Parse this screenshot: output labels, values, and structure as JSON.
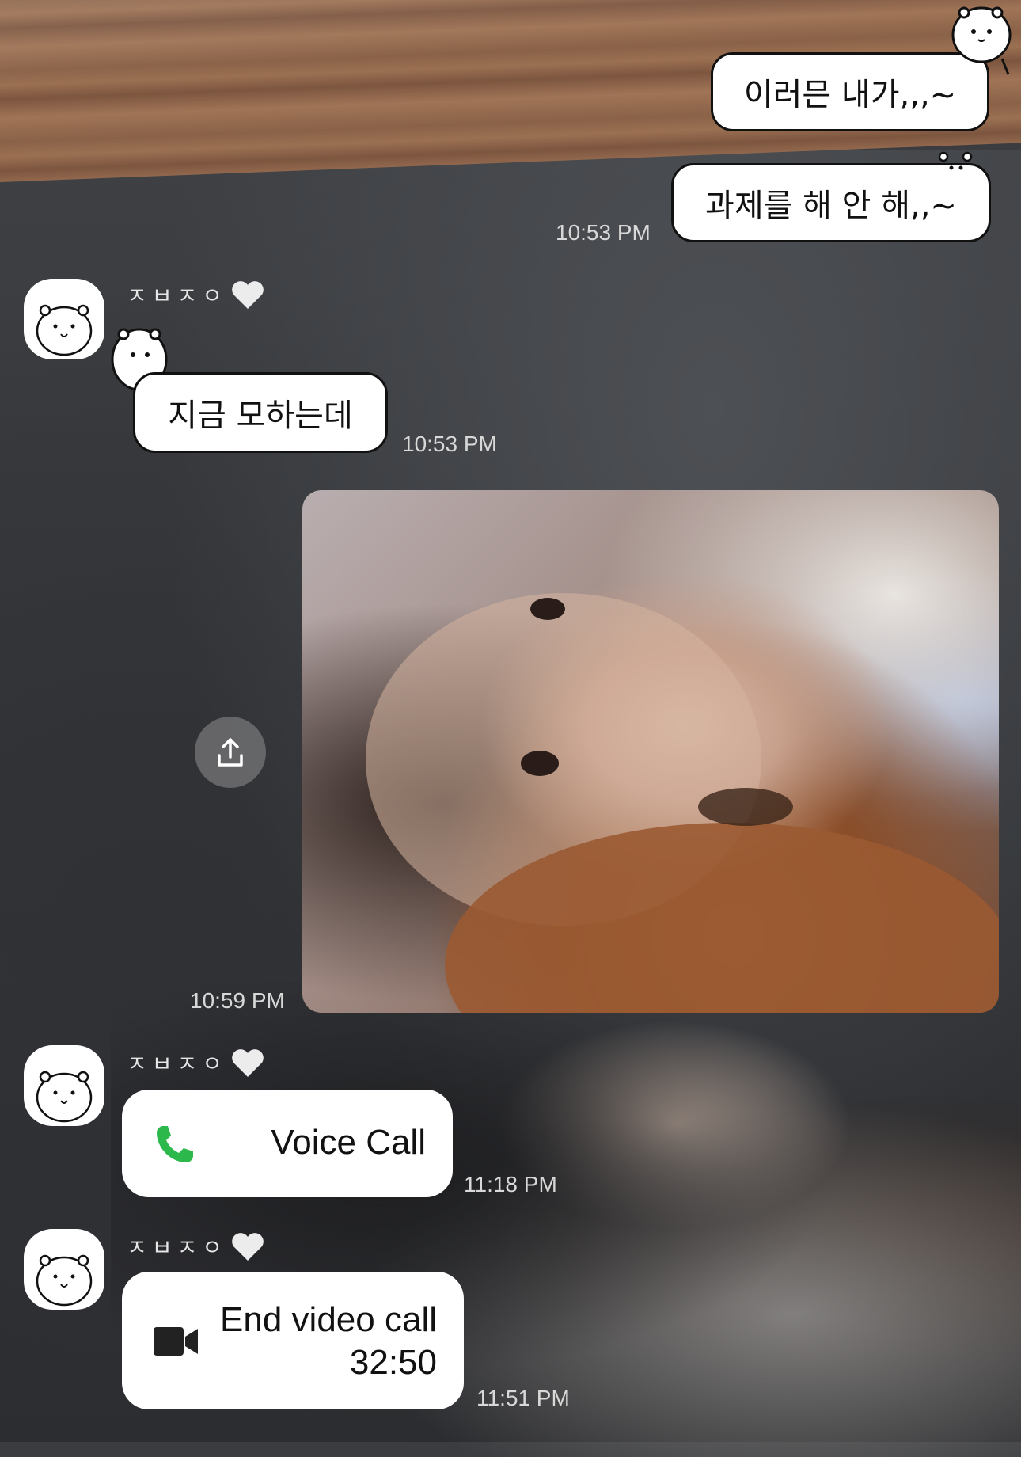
{
  "messages": {
    "out1": {
      "text": "이러믄 내가,,,~"
    },
    "out2": {
      "text": "과제를 해 안 해,,~",
      "time": "10:53 PM"
    },
    "in1": {
      "sender": "ㅈㅂㅈㅇ",
      "text": "지금 모하는데",
      "time": "10:53 PM"
    },
    "photo": {
      "time": "10:59 PM"
    },
    "call1": {
      "sender": "ㅈㅂㅈㅇ",
      "label": "Voice Call",
      "time": "11:18 PM"
    },
    "call2": {
      "sender": "ㅈㅂㅈㅇ",
      "label": "End video call",
      "duration": "32:50",
      "time": "11:51 PM"
    }
  },
  "icons": {
    "phone": "phone-icon",
    "video": "video-camera-icon",
    "share": "share-upload-icon",
    "heart": "white-heart-icon",
    "avatar": "bear-avatar-icon"
  },
  "colors": {
    "phone_green": "#2DB84B",
    "bubble_bg": "#FFFFFF",
    "timestamp": "#D8D8D8"
  }
}
